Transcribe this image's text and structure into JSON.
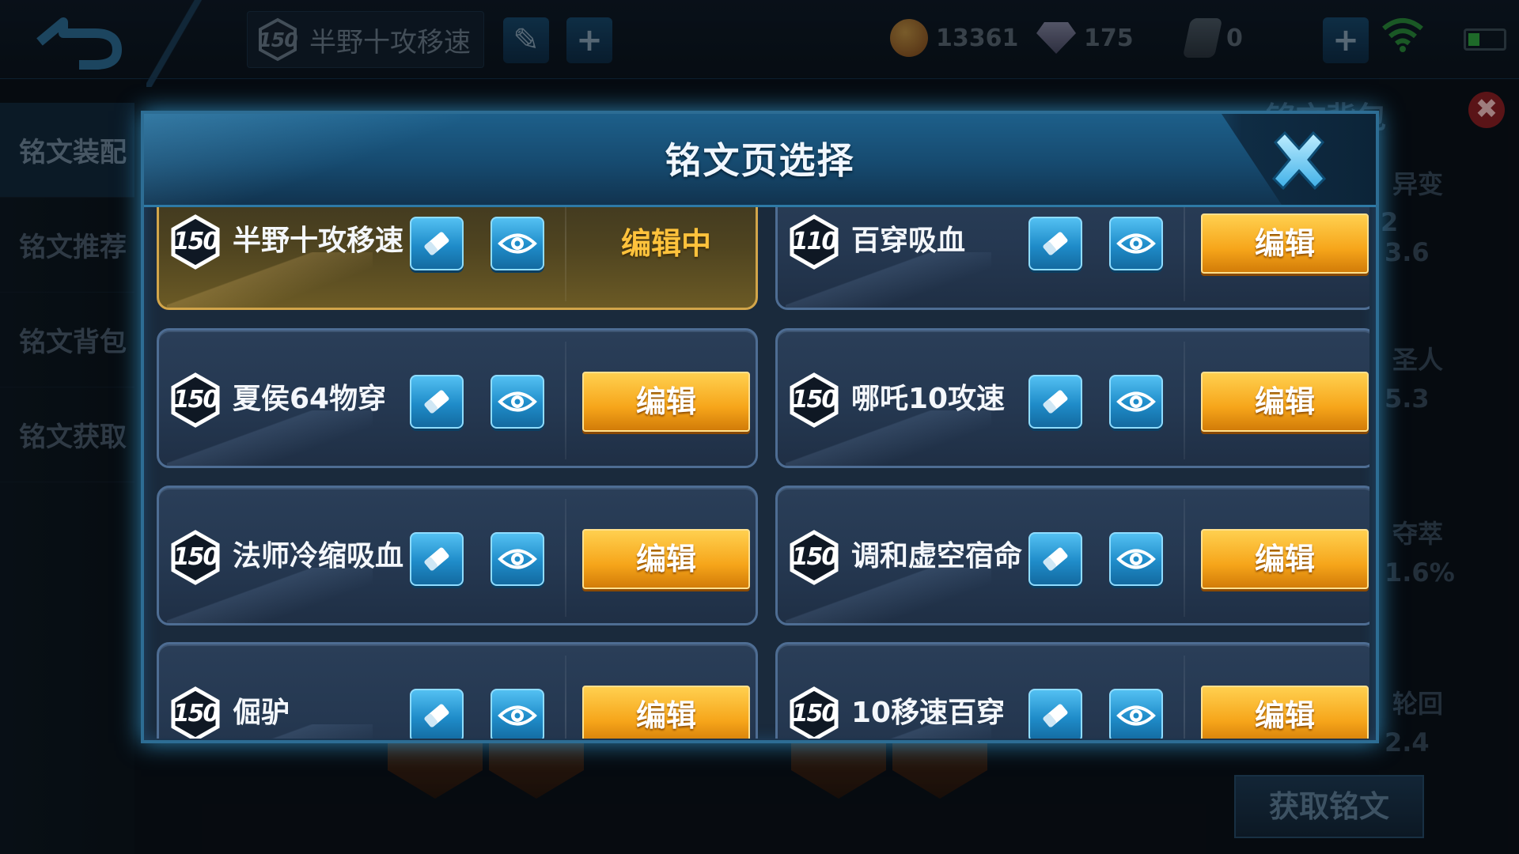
{
  "topbar": {
    "current_page": {
      "level": "150",
      "name": "半野十攻移速"
    },
    "currencies": [
      {
        "icon": "gold-coin-icon",
        "value": "13361"
      },
      {
        "icon": "diamond-icon",
        "value": "175"
      },
      {
        "icon": "voucher-icon",
        "value": "0"
      }
    ]
  },
  "sidebar": {
    "items": [
      {
        "label": "铭文装配",
        "active": true
      },
      {
        "label": "铭文推荐",
        "active": false
      },
      {
        "label": "铭文背包",
        "active": false
      },
      {
        "label": "铭文获取",
        "active": false
      }
    ]
  },
  "right_panel": {
    "title": "铭文背包",
    "fragments": [
      "异变",
      "2",
      "3.6",
      "圣人",
      "5.3",
      "夺萃",
      "1.6%",
      "轮回",
      "2.4"
    ],
    "get_button": "获取铭文"
  },
  "modal": {
    "title": "铭文页选择",
    "pages": [
      {
        "level": "150",
        "name": "半野十攻移速",
        "status": "编辑中",
        "active": true
      },
      {
        "level": "110",
        "name": "百穿吸血",
        "status": "编辑",
        "active": false
      },
      {
        "level": "150",
        "name": "夏侯64物穿",
        "status": "编辑",
        "active": false
      },
      {
        "level": "150",
        "name": "哪吒10攻速",
        "status": "编辑",
        "active": false
      },
      {
        "level": "150",
        "name": "法师冷缩吸血",
        "status": "编辑",
        "active": false
      },
      {
        "level": "150",
        "name": "调和虚空宿命",
        "status": "编辑",
        "active": false
      },
      {
        "level": "150",
        "name": "倔驴",
        "status": "编辑",
        "active": false
      },
      {
        "level": "150",
        "name": "10移速百穿",
        "status": "编辑",
        "active": false
      }
    ]
  },
  "colors": {
    "edit_button": "#f6a51a",
    "editing_text": "#ffc23c",
    "icon_button": "#1f8cc9",
    "modal_glow": "#3caae6"
  }
}
